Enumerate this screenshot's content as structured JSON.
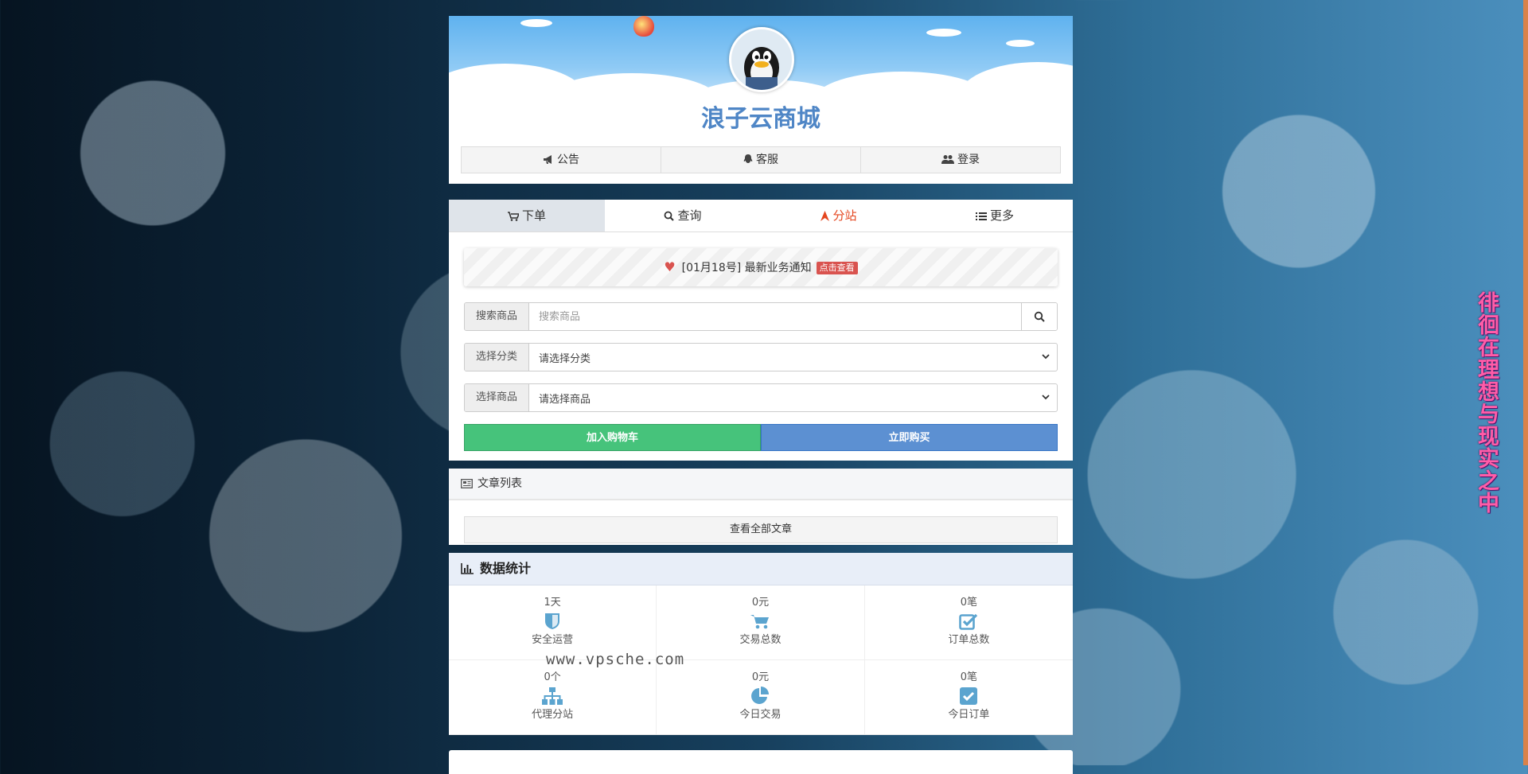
{
  "site": {
    "title": "浪子云商城"
  },
  "top_nav": [
    {
      "label": "公告",
      "icon": "megaphone-icon"
    },
    {
      "label": "客服",
      "icon": "qq-icon"
    },
    {
      "label": "登录",
      "icon": "users-icon"
    }
  ],
  "tabs": [
    {
      "label": "下单",
      "icon": "cart-icon"
    },
    {
      "label": "查询",
      "icon": "search-icon"
    },
    {
      "label": "分站",
      "icon": "location-arrow-icon"
    },
    {
      "label": "更多",
      "icon": "list-icon"
    }
  ],
  "notice": {
    "text": "[01月18号] 最新业务通知",
    "badge": "点击查看"
  },
  "form": {
    "search_label": "搜索商品",
    "search_placeholder": "搜索商品",
    "category_label": "选择分类",
    "category_value": "请选择分类",
    "product_label": "选择商品",
    "product_value": "请选择商品",
    "add_to_cart": "加入购物车",
    "buy_now": "立即购买"
  },
  "articles": {
    "header": "文章列表",
    "view_all": "查看全部文章"
  },
  "stats": {
    "header": "数据统计",
    "items": [
      {
        "value": "1天",
        "label": "安全运营",
        "icon": "shield-icon"
      },
      {
        "value": "0元",
        "label": "交易总数",
        "icon": "cart-icon"
      },
      {
        "value": "0笔",
        "label": "订单总数",
        "icon": "checkbox-icon"
      },
      {
        "value": "0个",
        "label": "代理分站",
        "icon": "sitemap-icon"
      },
      {
        "value": "0元",
        "label": "今日交易",
        "icon": "pie-chart-icon"
      },
      {
        "value": "0笔",
        "label": "今日订单",
        "icon": "check-square-icon"
      }
    ]
  },
  "side_text": "徘徊在理想与现实之中",
  "watermark": "www.vpsche.com",
  "colors": {
    "accent_blue": "#4f86c6",
    "green": "#46c37b",
    "blue": "#5c90d2",
    "red": "#d9534f",
    "orange": "#e4461f",
    "stat_icon": "#5ba4cf"
  }
}
